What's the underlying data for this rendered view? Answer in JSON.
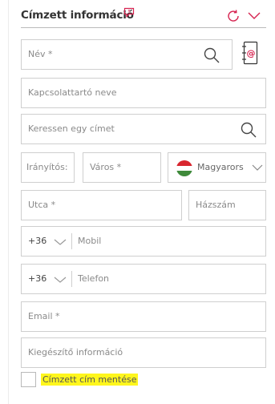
{
  "header": {
    "title": "Címzett információ",
    "title_icon": "comment-icon",
    "accent_color": "#d6224f"
  },
  "form": {
    "name_placeholder": "Név *",
    "contact_name_placeholder": "Kapcsolattartó neve",
    "address_search_placeholder": "Keressen egy címet",
    "zip_placeholder": "Irányítós:",
    "city_placeholder": "Város *",
    "country_value": "Magyarors",
    "street_placeholder": "Utca *",
    "house_number_placeholder": "Házszám",
    "mobile_prefix": "+36",
    "mobile_placeholder": "Mobil",
    "phone_prefix": "+36",
    "phone_placeholder": "Telefon",
    "email_placeholder": "Email *",
    "extra_info_placeholder": "Kiegészítő információ"
  },
  "save_address": {
    "label": "Címzett cím mentése",
    "checked": false,
    "highlight_color": "#fff61d"
  }
}
